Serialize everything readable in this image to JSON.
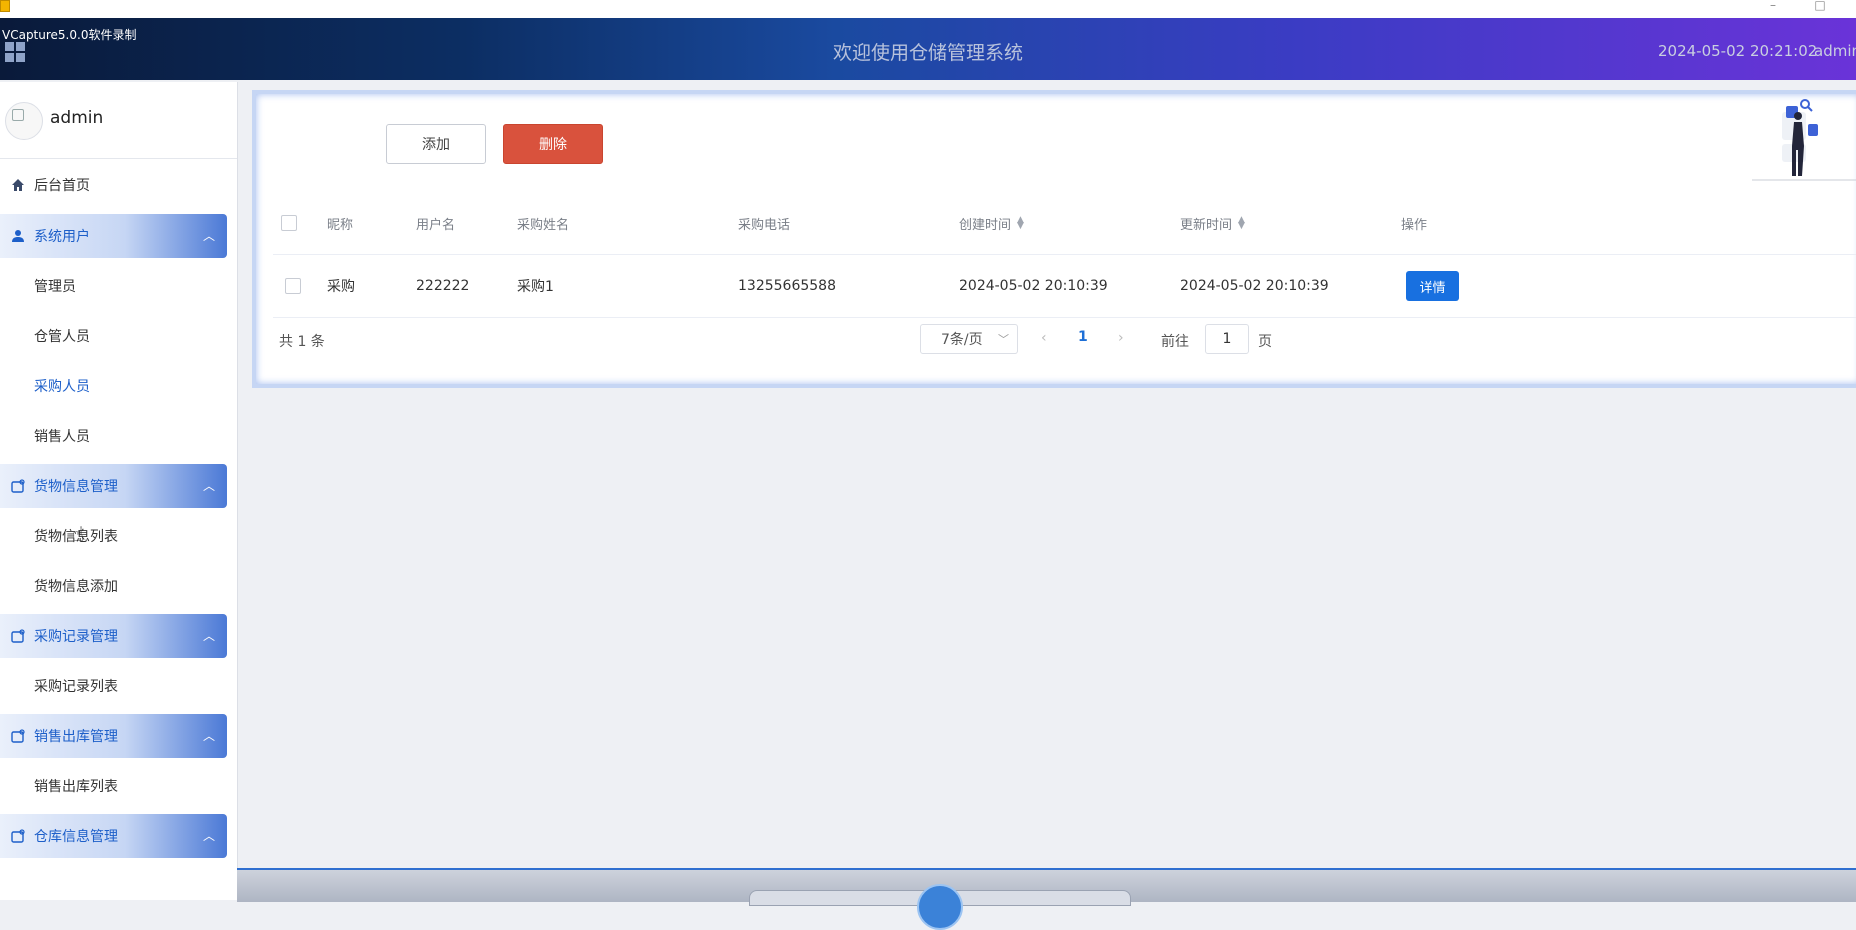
{
  "window": {
    "recorder_label": "VCapture5.0.0软件录制",
    "minimize_glyph": "–",
    "maximize_glyph": "□"
  },
  "header": {
    "title": "欢迎使用仓储管理系统",
    "datetime": "2024-05-02 20:21:02",
    "user": "admin"
  },
  "sidebar": {
    "profile_name": "admin",
    "home_label": "后台首页",
    "groups": [
      {
        "label": "系统用户",
        "icon": "user-icon",
        "items": [
          "管理员",
          "仓管人员",
          "采购人员",
          "销售人员"
        ]
      },
      {
        "label": "货物信息管理",
        "icon": "folder-icon",
        "items": [
          "货物信息列表",
          "货物信息添加"
        ]
      },
      {
        "label": "采购记录管理",
        "icon": "folder-icon",
        "items": [
          "采购记录列表"
        ]
      },
      {
        "label": "销售出库管理",
        "icon": "folder-icon",
        "items": [
          "销售出库列表"
        ]
      },
      {
        "label": "仓库信息管理",
        "icon": "folder-icon",
        "items": []
      }
    ],
    "active_item": "采购人员"
  },
  "toolbar": {
    "add_label": "添加",
    "delete_label": "删除"
  },
  "table": {
    "columns": [
      "昵称",
      "用户名",
      "采购姓名",
      "采购电话",
      "创建时间",
      "更新时间",
      "操作"
    ],
    "rows": [
      {
        "nickname": "采购",
        "username": "222222",
        "name": "采购1",
        "phone": "13255665588",
        "created": "2024-05-02 20:10:39",
        "updated": "2024-05-02 20:10:39",
        "action": "详情"
      }
    ]
  },
  "pagination": {
    "total_text": "共 1 条",
    "page_size": "7条/页",
    "current_page": "1",
    "goto_label": "前往",
    "goto_value": "1",
    "page_suffix": "页"
  },
  "colors": {
    "primary": "#1870e0",
    "danger": "#d9523d",
    "sidebar_accent": "#1d5fc9"
  }
}
